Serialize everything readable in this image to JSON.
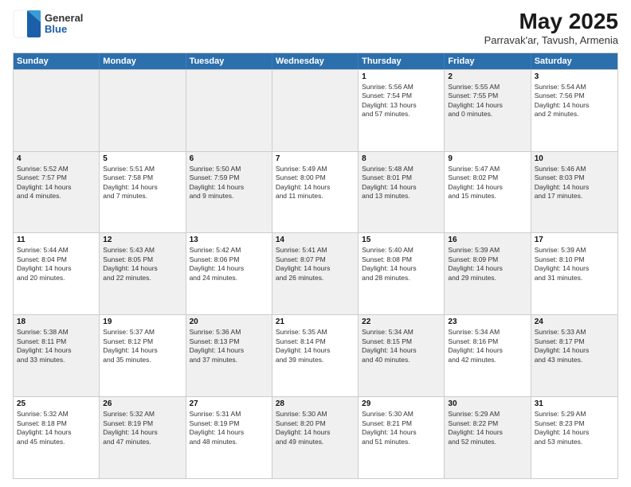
{
  "logo": {
    "general": "General",
    "blue": "Blue"
  },
  "title": "May 2025",
  "subtitle": "Parravak'ar, Tavush, Armenia",
  "header_days": [
    "Sunday",
    "Monday",
    "Tuesday",
    "Wednesday",
    "Thursday",
    "Friday",
    "Saturday"
  ],
  "weeks": [
    [
      {
        "day": "",
        "lines": [],
        "shaded": true
      },
      {
        "day": "",
        "lines": [],
        "shaded": true
      },
      {
        "day": "",
        "lines": [],
        "shaded": true
      },
      {
        "day": "",
        "lines": [],
        "shaded": true
      },
      {
        "day": "1",
        "lines": [
          "Sunrise: 5:56 AM",
          "Sunset: 7:54 PM",
          "Daylight: 13 hours",
          "and 57 minutes."
        ]
      },
      {
        "day": "2",
        "lines": [
          "Sunrise: 5:55 AM",
          "Sunset: 7:55 PM",
          "Daylight: 14 hours",
          "and 0 minutes."
        ],
        "shaded": true
      },
      {
        "day": "3",
        "lines": [
          "Sunrise: 5:54 AM",
          "Sunset: 7:56 PM",
          "Daylight: 14 hours",
          "and 2 minutes."
        ]
      }
    ],
    [
      {
        "day": "4",
        "lines": [
          "Sunrise: 5:52 AM",
          "Sunset: 7:57 PM",
          "Daylight: 14 hours",
          "and 4 minutes."
        ],
        "shaded": true
      },
      {
        "day": "5",
        "lines": [
          "Sunrise: 5:51 AM",
          "Sunset: 7:58 PM",
          "Daylight: 14 hours",
          "and 7 minutes."
        ]
      },
      {
        "day": "6",
        "lines": [
          "Sunrise: 5:50 AM",
          "Sunset: 7:59 PM",
          "Daylight: 14 hours",
          "and 9 minutes."
        ],
        "shaded": true
      },
      {
        "day": "7",
        "lines": [
          "Sunrise: 5:49 AM",
          "Sunset: 8:00 PM",
          "Daylight: 14 hours",
          "and 11 minutes."
        ]
      },
      {
        "day": "8",
        "lines": [
          "Sunrise: 5:48 AM",
          "Sunset: 8:01 PM",
          "Daylight: 14 hours",
          "and 13 minutes."
        ],
        "shaded": true
      },
      {
        "day": "9",
        "lines": [
          "Sunrise: 5:47 AM",
          "Sunset: 8:02 PM",
          "Daylight: 14 hours",
          "and 15 minutes."
        ]
      },
      {
        "day": "10",
        "lines": [
          "Sunrise: 5:46 AM",
          "Sunset: 8:03 PM",
          "Daylight: 14 hours",
          "and 17 minutes."
        ],
        "shaded": true
      }
    ],
    [
      {
        "day": "11",
        "lines": [
          "Sunrise: 5:44 AM",
          "Sunset: 8:04 PM",
          "Daylight: 14 hours",
          "and 20 minutes."
        ]
      },
      {
        "day": "12",
        "lines": [
          "Sunrise: 5:43 AM",
          "Sunset: 8:05 PM",
          "Daylight: 14 hours",
          "and 22 minutes."
        ],
        "shaded": true
      },
      {
        "day": "13",
        "lines": [
          "Sunrise: 5:42 AM",
          "Sunset: 8:06 PM",
          "Daylight: 14 hours",
          "and 24 minutes."
        ]
      },
      {
        "day": "14",
        "lines": [
          "Sunrise: 5:41 AM",
          "Sunset: 8:07 PM",
          "Daylight: 14 hours",
          "and 26 minutes."
        ],
        "shaded": true
      },
      {
        "day": "15",
        "lines": [
          "Sunrise: 5:40 AM",
          "Sunset: 8:08 PM",
          "Daylight: 14 hours",
          "and 28 minutes."
        ]
      },
      {
        "day": "16",
        "lines": [
          "Sunrise: 5:39 AM",
          "Sunset: 8:09 PM",
          "Daylight: 14 hours",
          "and 29 minutes."
        ],
        "shaded": true
      },
      {
        "day": "17",
        "lines": [
          "Sunrise: 5:39 AM",
          "Sunset: 8:10 PM",
          "Daylight: 14 hours",
          "and 31 minutes."
        ]
      }
    ],
    [
      {
        "day": "18",
        "lines": [
          "Sunrise: 5:38 AM",
          "Sunset: 8:11 PM",
          "Daylight: 14 hours",
          "and 33 minutes."
        ],
        "shaded": true
      },
      {
        "day": "19",
        "lines": [
          "Sunrise: 5:37 AM",
          "Sunset: 8:12 PM",
          "Daylight: 14 hours",
          "and 35 minutes."
        ]
      },
      {
        "day": "20",
        "lines": [
          "Sunrise: 5:36 AM",
          "Sunset: 8:13 PM",
          "Daylight: 14 hours",
          "and 37 minutes."
        ],
        "shaded": true
      },
      {
        "day": "21",
        "lines": [
          "Sunrise: 5:35 AM",
          "Sunset: 8:14 PM",
          "Daylight: 14 hours",
          "and 39 minutes."
        ]
      },
      {
        "day": "22",
        "lines": [
          "Sunrise: 5:34 AM",
          "Sunset: 8:15 PM",
          "Daylight: 14 hours",
          "and 40 minutes."
        ],
        "shaded": true
      },
      {
        "day": "23",
        "lines": [
          "Sunrise: 5:34 AM",
          "Sunset: 8:16 PM",
          "Daylight: 14 hours",
          "and 42 minutes."
        ]
      },
      {
        "day": "24",
        "lines": [
          "Sunrise: 5:33 AM",
          "Sunset: 8:17 PM",
          "Daylight: 14 hours",
          "and 43 minutes."
        ],
        "shaded": true
      }
    ],
    [
      {
        "day": "25",
        "lines": [
          "Sunrise: 5:32 AM",
          "Sunset: 8:18 PM",
          "Daylight: 14 hours",
          "and 45 minutes."
        ]
      },
      {
        "day": "26",
        "lines": [
          "Sunrise: 5:32 AM",
          "Sunset: 8:19 PM",
          "Daylight: 14 hours",
          "and 47 minutes."
        ],
        "shaded": true
      },
      {
        "day": "27",
        "lines": [
          "Sunrise: 5:31 AM",
          "Sunset: 8:19 PM",
          "Daylight: 14 hours",
          "and 48 minutes."
        ]
      },
      {
        "day": "28",
        "lines": [
          "Sunrise: 5:30 AM",
          "Sunset: 8:20 PM",
          "Daylight: 14 hours",
          "and 49 minutes."
        ],
        "shaded": true
      },
      {
        "day": "29",
        "lines": [
          "Sunrise: 5:30 AM",
          "Sunset: 8:21 PM",
          "Daylight: 14 hours",
          "and 51 minutes."
        ]
      },
      {
        "day": "30",
        "lines": [
          "Sunrise: 5:29 AM",
          "Sunset: 8:22 PM",
          "Daylight: 14 hours",
          "and 52 minutes."
        ],
        "shaded": true
      },
      {
        "day": "31",
        "lines": [
          "Sunrise: 5:29 AM",
          "Sunset: 8:23 PM",
          "Daylight: 14 hours",
          "and 53 minutes."
        ]
      }
    ]
  ]
}
